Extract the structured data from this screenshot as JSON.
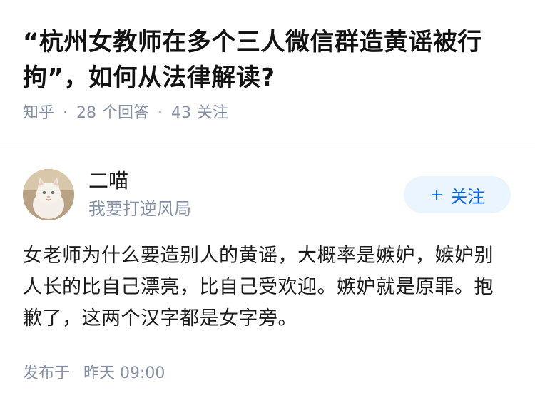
{
  "question": {
    "title": "“杭州女教师在多个三人微信群造黄谣被行拘”，如何从法律解读?",
    "source": "知乎",
    "answer_count": "28",
    "answer_label": "个回答",
    "follow_count": "43",
    "follow_label": "关注"
  },
  "author": {
    "name": "二喵",
    "bio": "我要打逆风局",
    "avatar_icon": "cat-avatar",
    "follow_button": "关注",
    "follow_icon": "plus-icon"
  },
  "answer": {
    "content": "女老师为什么要造别人的黄谣，大概率是嫉妒，嫉妒别人长的比自己漂亮，比自己受欢迎。嫉妒就是原罪。抱歉了，这两个汉字都是女字旁。",
    "published_label": "发布于",
    "published_time": "昨天 09:00"
  },
  "colors": {
    "meta_gray": "#8590a6",
    "accent_blue": "#0066ff",
    "button_bg": "#ebf5ff"
  }
}
